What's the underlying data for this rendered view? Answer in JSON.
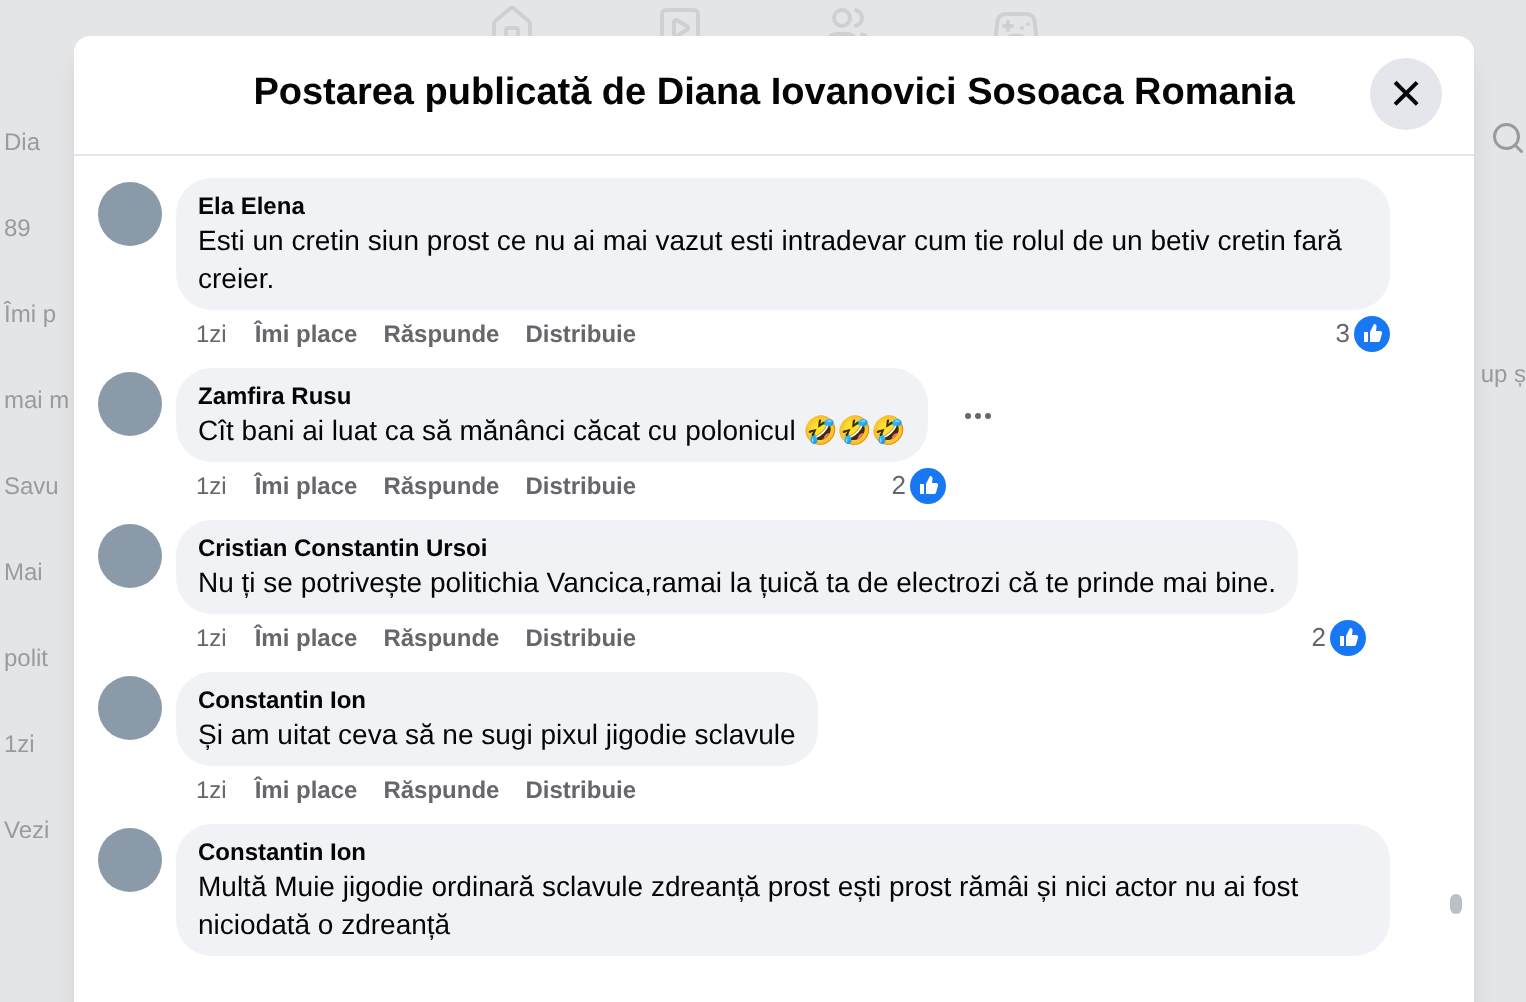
{
  "background": {
    "left_fragments": [
      "Dia",
      "89",
      "Îmi p",
      "mai m",
      "Savu",
      "Mai",
      "polit",
      "1zi",
      "Vezi"
    ],
    "right_fragments": [
      "up ș"
    ]
  },
  "dialog": {
    "title": "Postarea publicată de Diana Iovanovici Sosoaca Romania",
    "close": "×"
  },
  "comments": [
    {
      "author": "Ela Elena",
      "text": "Esti un cretin siun prost ce nu ai mai vazut esti intradevar cum tie rolul de un betiv cretin fară creier.",
      "time": "1zi",
      "actions": [
        "Îmi place",
        "Răspunde",
        "Distribuie"
      ],
      "like_count": "3",
      "menu": false
    },
    {
      "author": "Zamfira Rusu",
      "text": "Cît bani ai luat ca să mănânci căcat cu polonicul 🤣🤣🤣",
      "time": "1zi",
      "actions": [
        "Îmi place",
        "Răspunde",
        "Distribuie"
      ],
      "like_count": "2",
      "menu": true
    },
    {
      "author": "Cristian Constantin Ursoi",
      "text": "Nu ți se potrivește politichia Vancica,ramai la țuică ta de electrozi că te prinde mai bine.",
      "time": "1zi",
      "actions": [
        "Îmi place",
        "Răspunde",
        "Distribuie"
      ],
      "like_count": "2",
      "menu": false
    },
    {
      "author": "Constantin Ion",
      "text": "Și am uitat ceva să ne sugi pixul jigodie sclavule",
      "time": "1zi",
      "actions": [
        "Îmi place",
        "Răspunde",
        "Distribuie"
      ],
      "menu": false
    },
    {
      "author": "Constantin Ion",
      "text": "Multă Muie jigodie ordinară sclavule zdreanță prost ești prost rămâi și nici actor nu ai fost niciodată o zdreanță",
      "menu": false
    }
  ]
}
